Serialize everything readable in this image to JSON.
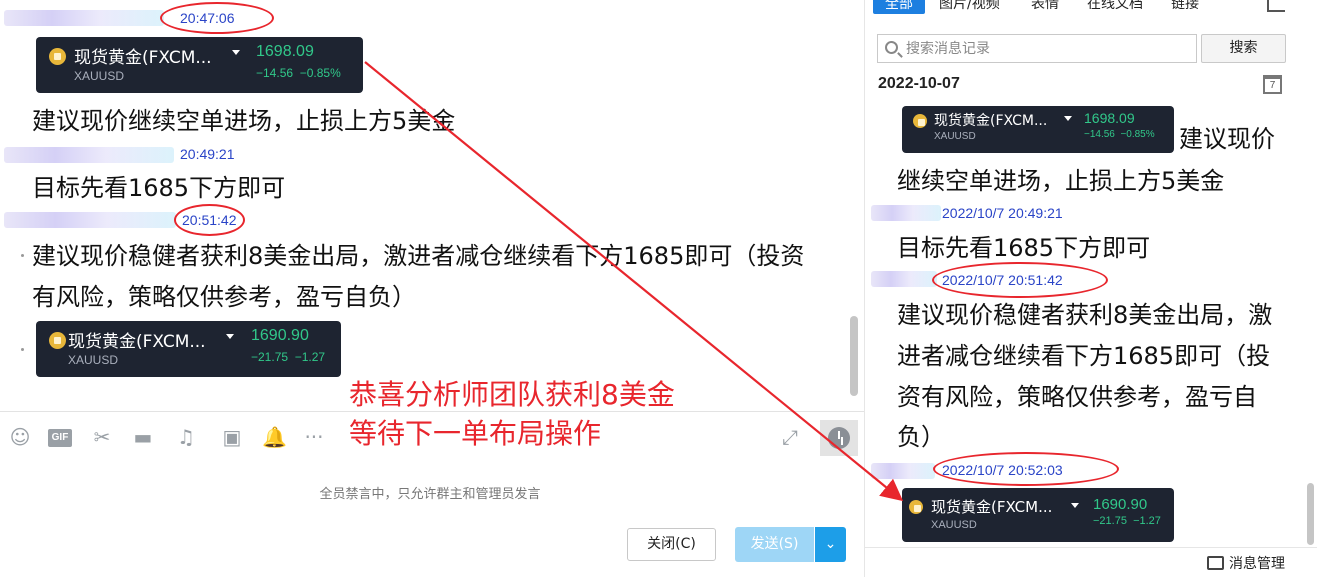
{
  "chat": {
    "messages": [
      {
        "time": "20:47:06",
        "quote": {
          "name": "现货黄金(FXCM...",
          "symbol": "XAUUSD",
          "price": "1698.09",
          "change": "−14.56",
          "change_pct": "−0.85%"
        },
        "text": "建议现价继续空单进场，止损上方5美金"
      },
      {
        "time": "20:49:21",
        "text": "目标先看1685下方即可"
      },
      {
        "time": "20:51:42",
        "text_line1": "建议现价稳健者获利8美金出局，激进者减仓继续看下方1685即可（投资",
        "text_line2": "有风险，策略仅供参考，盈亏自负）",
        "quote": {
          "name": "现货黄金(FXCM...",
          "symbol": "XAUUSD",
          "price": "1690.90",
          "change": "−21.75",
          "change_pct": "−1.27"
        }
      }
    ],
    "annotation_line1": "恭喜分析师团队获利8美金",
    "annotation_line2": "等待下一单布局操作",
    "notice": "全员禁言中，只允许群主和管理员发言",
    "close_label": "关闭(C)",
    "send_label": "发送(S)",
    "toolbar_icons": [
      "emoji-icon",
      "gif-icon",
      "scissors-icon",
      "folder-icon",
      "music-icon",
      "image-icon",
      "bell-icon",
      "more-icon"
    ],
    "gif_label": "GIF"
  },
  "history": {
    "tabs": [
      "全部",
      "图片/视频",
      "表情",
      "在线文档",
      "链接"
    ],
    "search_placeholder": "搜索消息记录",
    "search_label": "搜索",
    "date": "2022-10-07",
    "calendar_day": "7",
    "messages": [
      {
        "quote": {
          "name": "现货黄金(FXCM...",
          "symbol": "XAUUSD",
          "price": "1698.09",
          "change": "−14.56",
          "change_pct": "−0.85%"
        },
        "text_line1": "建议现价",
        "text_line2": "继续空单进场，止损上方5美金"
      },
      {
        "time": "2022/10/7 20:49:21",
        "text": "目标先看1685下方即可"
      },
      {
        "time": "2022/10/7 20:51:42",
        "text_line1": "建议现价稳健者获利8美金出局，激",
        "text_line2": "进者减仓继续看下方1685即可（投",
        "text_line3": "资有风险，策略仅供参考，盈亏自",
        "text_line4": "负）"
      },
      {
        "time": "2022/10/7 20:52:03",
        "quote": {
          "name": "现货黄金(FXCM...",
          "symbol": "XAUUSD",
          "price": "1690.90",
          "change": "−21.75",
          "change_pct": "−1.27"
        }
      }
    ],
    "manage_label": "消息管理"
  },
  "colors": {
    "accent": "#1d7fe0",
    "annotation_red": "#e8262d",
    "timestamp_blue": "#2a44c7",
    "quote_green": "#31c88a",
    "quote_bg": "#1e2431"
  }
}
